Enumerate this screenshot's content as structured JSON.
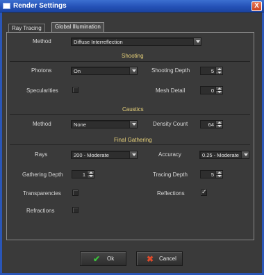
{
  "window": {
    "title": "Render Settings",
    "close_glyph": "X",
    "app_icon": "window-icon"
  },
  "tabs": [
    {
      "label": "Ray Tracing",
      "active": false
    },
    {
      "label": "Global Illumination",
      "active": true
    }
  ],
  "method": {
    "label": "Method",
    "value": "Diffuse Interreflection"
  },
  "shooting": {
    "title": "Shooting",
    "photons_label": "Photons",
    "photons_value": "On",
    "shooting_depth_label": "Shooting Depth",
    "shooting_depth_value": "5",
    "specularities_label": "Specularities",
    "specularities_checked": false,
    "mesh_detail_label": "Mesh Detail",
    "mesh_detail_value": "0"
  },
  "caustics": {
    "title": "Caustics",
    "method_label": "Method",
    "method_value": "None",
    "density_count_label": "Density Count",
    "density_count_value": "64"
  },
  "final_gathering": {
    "title": "Final Gathering",
    "rays_label": "Rays",
    "rays_value": "200 - Moderate",
    "accuracy_label": "Accuracy",
    "accuracy_value": "0.25 - Moderate",
    "gathering_depth_label": "Gathering Depth",
    "gathering_depth_value": "1",
    "tracing_depth_label": "Tracing Depth",
    "tracing_depth_value": "5",
    "transparencies_label": "Transparencies",
    "transparencies_checked": false,
    "reflections_label": "Reflections",
    "reflections_checked": true,
    "refractions_label": "Refractions",
    "refractions_checked": false
  },
  "buttons": {
    "ok_label": "Ok",
    "ok_icon": "check-icon",
    "ok_color": "#3cc23c",
    "cancel_label": "Cancel",
    "cancel_icon": "x-icon",
    "cancel_color": "#e04a2a"
  },
  "checkmark_glyph": "✓"
}
